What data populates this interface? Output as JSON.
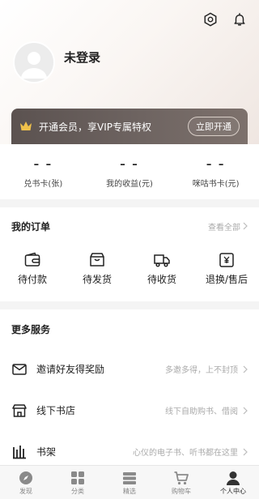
{
  "header": {
    "settings_icon": "settings-hex-icon",
    "notification_icon": "bell-icon"
  },
  "profile": {
    "avatar_icon": "default-avatar-icon",
    "name": "未登录"
  },
  "vip": {
    "icon": "crown-icon",
    "text": "开通会员，享VIP专属特权",
    "button": "立即开通",
    "colors": {
      "crown": "#f0c14b",
      "bar": "#6e6461"
    }
  },
  "stats": [
    {
      "value": "– –",
      "label": "兑书卡(张)"
    },
    {
      "value": "– –",
      "label": "我的收益(元)"
    },
    {
      "value": "– –",
      "label": "咪咕书卡(元)"
    }
  ],
  "orders": {
    "title": "我的订单",
    "view_all": "查看全部",
    "items": [
      {
        "icon": "wallet-icon",
        "label": "待付款"
      },
      {
        "icon": "box-icon",
        "label": "待发货"
      },
      {
        "icon": "truck-icon",
        "label": "待收货"
      },
      {
        "icon": "refund-icon",
        "label": "退换/售后"
      }
    ]
  },
  "services": {
    "title": "更多服务",
    "items": [
      {
        "icon": "mail-icon",
        "label": "邀请好友得奖励",
        "desc": "多邀多得，上不封顶"
      },
      {
        "icon": "store-icon",
        "label": "线下书店",
        "desc": "线下自助购书、借阅"
      },
      {
        "icon": "bookshelf-icon",
        "label": "书架",
        "desc": "心仪的电子书、听书都在这里"
      }
    ]
  },
  "tabbar": [
    {
      "icon": "compass-icon",
      "label": "发现"
    },
    {
      "icon": "grid-icon",
      "label": "分类"
    },
    {
      "icon": "layers-icon",
      "label": "精选"
    },
    {
      "icon": "cart-icon",
      "label": "购物车"
    },
    {
      "icon": "user-icon",
      "label": "个人中心",
      "active": true
    }
  ]
}
